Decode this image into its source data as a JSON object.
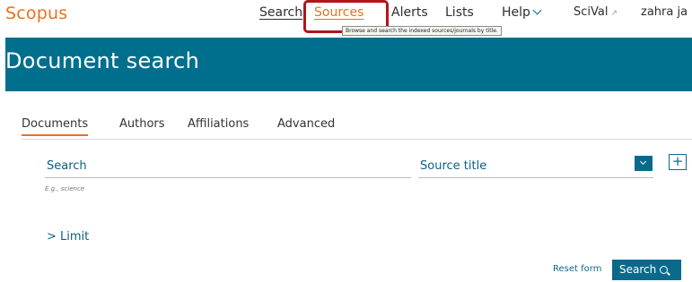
{
  "header": {
    "logo": "Scopus",
    "nav": {
      "search": "Search",
      "sources": "Sources",
      "alerts": "Alerts",
      "lists": "Lists",
      "help": "Help",
      "scival": "SciVal",
      "user": "zahra ja"
    },
    "tooltip": "Browse and search the indexed sources/journals by title."
  },
  "banner": {
    "title": "Document search"
  },
  "tabs": [
    "Documents",
    "Authors",
    "Affiliations",
    "Advanced"
  ],
  "search_form": {
    "search_label": "Search",
    "search_hint": "E.g., science",
    "field_select": "Source title",
    "limit_label": "> Limit",
    "reset_label": "Reset form",
    "submit_label": "Search"
  },
  "colors": {
    "brand_orange": "#e9711c",
    "banner_teal": "#006f8e",
    "link_blue": "#0b6a8c",
    "highlight_red": "#b3141c"
  }
}
